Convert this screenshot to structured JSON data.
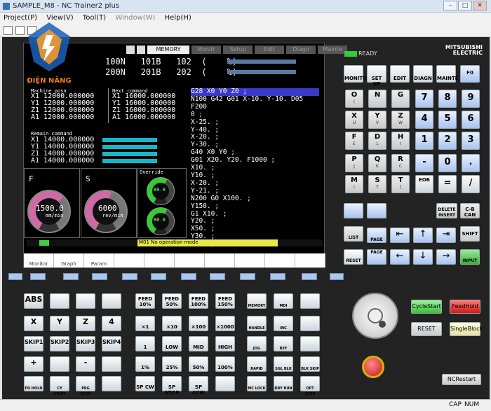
{
  "window": {
    "title": "SAMPLE_M8 - NC Trainer2 plus",
    "buttons": [
      "–",
      "□",
      "✕"
    ]
  },
  "menu": {
    "items": [
      {
        "label": "Project(P)",
        "enabled": true
      },
      {
        "label": "View(V)",
        "enabled": true
      },
      {
        "label": "Tool(T)",
        "enabled": true
      },
      {
        "label": "Window(W)",
        "enabled": false
      },
      {
        "label": "Help(H)",
        "enabled": true
      }
    ]
  },
  "watermark": {
    "text": "ĐIỆN NĂNG"
  },
  "screen": {
    "tabs": [
      "",
      "",
      "MEMORY",
      "Monitr",
      "Setup",
      "Edit",
      "Diagn",
      "Mainte"
    ],
    "rows": [
      {
        "n": "100N",
        "b": "101B",
        "c": "102",
        "u": "(",
        "pct": "%)",
        "fill": 0.55
      },
      {
        "n": "200N",
        "b": "201B",
        "c": "202",
        "u": "(",
        "pct": "%)",
        "fill": 0.55
      }
    ],
    "machine": {
      "title": "Machine posn",
      "lines": [
        "X1  12000.000000",
        "Y1  12000.000000",
        "Z1  12000.000000",
        "A1  12000.000000"
      ]
    },
    "next": {
      "title": "Next command",
      "lines": [
        "X1  16000.000000",
        "Y1  16000.000000",
        "Z1  16000.000000",
        "A1  16000.000000"
      ]
    },
    "remain": {
      "title": "Remain command",
      "lines": [
        "X1  14000.000000",
        "Y1  14000.000000",
        "Z1  14000.000000",
        "A1  14000.000000"
      ]
    },
    "program": {
      "highlight": "G28 X0 Y0 Z0 ;",
      "lines": [
        "N100 G42 G01 X-10. Y-10. D05 F200",
        "0 ;",
        "X-25. ;",
        "Y-40. ;",
        "X-20. ;",
        "Y-30. ;",
        "G40 X0 Y0 ;",
        "G01 X20. Y20. F1000 ;",
        "X10. ;",
        "Y10. ;",
        "X-20. ;",
        "Y-21. ;",
        "N200 G0 X100. ;",
        "Y150. ;",
        "G1 X10. ;",
        "Y20. ;",
        "X50. ;",
        "Y30. ;",
        "X20. ;"
      ]
    },
    "f_label": "F",
    "s_label": "S",
    "f_value": "1500.0",
    "f_unit": "mm/min",
    "s_value": "6000",
    "s_unit": "rev/min",
    "f_fill": 0.65,
    "s_fill": 0.55,
    "override": {
      "title": "Override",
      "v1": "80.0",
      "v2": "80.0",
      "fill1": 0.6,
      "fill2": 0.6
    },
    "alarm": {
      "tag": "M01",
      "text": "M01 No operation mode"
    },
    "softkeys": [
      "Monitor",
      "Graph",
      "Param",
      "",
      "",
      "",
      "",
      "",
      "",
      ""
    ]
  },
  "right": {
    "ready": "READY",
    "brand": "MITSUBISHI ELECTRIC",
    "topbtns": [
      "MONITOR",
      "SET UP",
      "EDIT",
      "DIAGN",
      "MAINTE",
      "F0"
    ],
    "letters": [
      [
        "O",
        "(",
        "N",
        "",
        "G",
        "",
        ""
      ],
      [
        "X",
        "U",
        "Y",
        "V",
        "Z",
        "W"
      ],
      [
        "F",
        "E",
        "D",
        "L",
        "H",
        "I"
      ],
      [
        "P",
        "J",
        "Q",
        "K",
        "R",
        "C"
      ],
      [
        "M",
        "(",
        "S",
        "T",
        "T",
        "["
      ]
    ],
    "nums": [
      [
        "7",
        "8",
        "9"
      ],
      [
        "4",
        "5",
        "6"
      ],
      [
        "1",
        "2",
        "3"
      ],
      [
        "-",
        "0",
        "."
      ]
    ],
    "eob": "EOB",
    "eq": "=",
    "star": "/",
    "delete": "DELETE INSERT",
    "cb": "C-B CAN",
    "shift": "SHIFT",
    "list": "LIST",
    "reset": "RESET",
    "input": "INPUT",
    "page": "PAGE"
  },
  "lower": {
    "left": [
      [
        "ABS",
        "",
        "",
        ""
      ],
      [
        "X",
        "Y",
        "Z",
        "4"
      ],
      [
        "SKIP1",
        "SKIP2",
        "SKIP3",
        "SKIP4"
      ],
      [
        "+",
        "",
        "-",
        ""
      ],
      [
        "FD HOLD",
        "CY START",
        "PRG STOP",
        ""
      ]
    ],
    "feed": [
      [
        "FEED 10%",
        "FEED 50%",
        "FEED 100%",
        "FEED 150%"
      ],
      [
        "×1",
        "×10",
        "×100",
        "×1000"
      ],
      [
        "1",
        "LOW",
        "MID",
        "HIGH"
      ],
      [
        "1%",
        "25%",
        "50%",
        "100%"
      ],
      [
        "SP CW",
        "SP STOP",
        "SP CCW",
        ""
      ]
    ],
    "mode": [
      [
        "MEMORY",
        "MDI",
        ""
      ],
      [
        "HANDLE",
        "INC",
        ""
      ],
      [
        "JOG",
        "REF",
        ""
      ],
      [
        "RAPID",
        "SGL BLK",
        "BLK SKIP"
      ],
      [
        "MC LOCK",
        "DRY RUN",
        "OPT STOP"
      ]
    ],
    "cycle_start": "CycleStart",
    "feed_hold": "FeedHold",
    "reset": "RESET",
    "single_block": "SingleBlock",
    "nc_restart": "NCRestart"
  },
  "status": {
    "cap": "CAP",
    "num": "NUM"
  },
  "colors": {
    "panel": "#232323",
    "screen": "#000000",
    "accent": "#d06aa4",
    "cyan": "#16b6c8",
    "ready": "#3c3"
  }
}
